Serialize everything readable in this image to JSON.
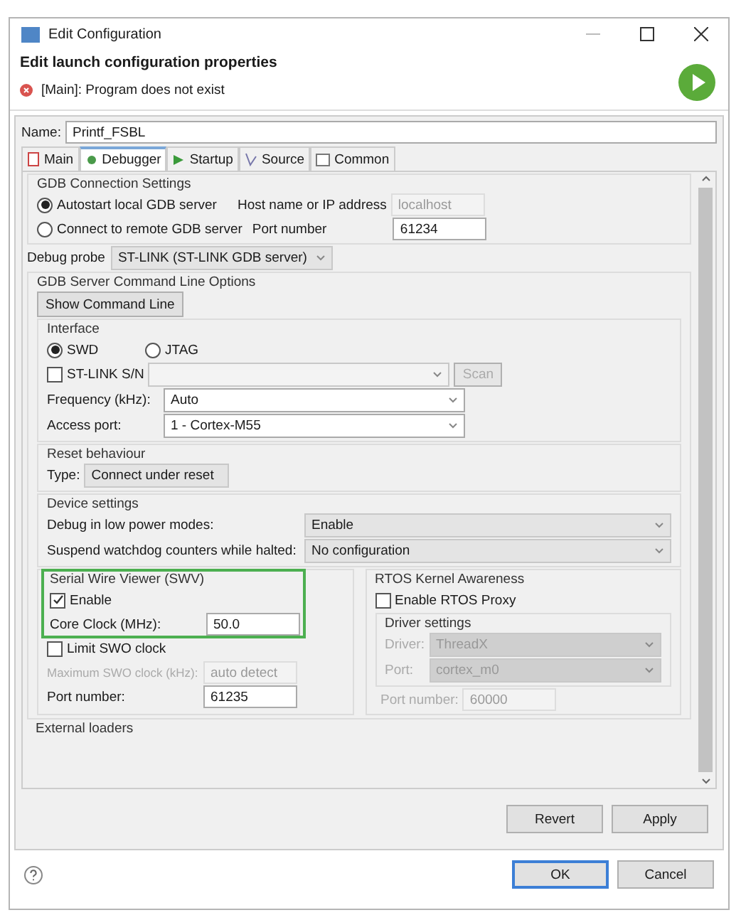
{
  "window": {
    "title": "Edit Configuration"
  },
  "header": {
    "title": "Edit launch configuration properties",
    "error": "[Main]: Program does not exist"
  },
  "name_field": {
    "label": "Name:",
    "value": "Printf_FSBL"
  },
  "tabs": [
    {
      "label": "Main",
      "selected": false
    },
    {
      "label": "Debugger",
      "selected": true
    },
    {
      "label": "Startup",
      "selected": false
    },
    {
      "label": "Source",
      "selected": false
    },
    {
      "label": "Common",
      "selected": false
    }
  ],
  "gdb_connection": {
    "title": "GDB Connection Settings",
    "options": [
      {
        "label": "Autostart local GDB server",
        "selected": true
      },
      {
        "label": "Connect to remote GDB server",
        "selected": false
      }
    ],
    "host": {
      "label": "Host name or IP address",
      "value": "localhost",
      "disabled": true
    },
    "port": {
      "label": "Port number",
      "value": "61234",
      "disabled": false
    }
  },
  "debug_probe": {
    "label": "Debug probe",
    "value": "ST-LINK (ST-LINK GDB server)"
  },
  "server_options": {
    "title": "GDB Server Command Line Options",
    "show_command_line": "Show Command Line",
    "interface": {
      "title": "Interface",
      "modes": [
        {
          "label": "SWD",
          "selected": true
        },
        {
          "label": "JTAG",
          "selected": false
        }
      ],
      "serial": {
        "label": "ST-LINK S/N",
        "checked": false,
        "value_disabled": true,
        "scan": "Scan"
      },
      "frequency": {
        "label": "Frequency (kHz):",
        "value": "Auto"
      },
      "access_port": {
        "label": "Access port:",
        "value": "1 - Cortex-M55"
      }
    },
    "reset": {
      "title": "Reset behaviour",
      "type": {
        "label": "Type:",
        "value": "Connect under reset"
      }
    },
    "device": {
      "title": "Device settings",
      "rows": [
        {
          "label": "Debug in low power modes:",
          "value": "Enable"
        },
        {
          "label": "Suspend watchdog counters while halted:",
          "value": "No configuration"
        }
      ]
    }
  },
  "swv": {
    "title": "Serial Wire Viewer (SWV)",
    "enable": {
      "label": "Enable",
      "checked": true
    },
    "core_clock": {
      "label": "Core Clock (MHz):",
      "value": "50.0"
    },
    "limit": {
      "label": "Limit SWO clock",
      "checked": false
    },
    "max_clock": {
      "label": "Maximum SWO clock (kHz):",
      "value": "auto detect",
      "disabled": true
    },
    "port": {
      "label": "Port number:",
      "value": "61235",
      "disabled": false
    }
  },
  "rtos": {
    "title": "RTOS Kernel Awareness",
    "enable": {
      "label": "Enable RTOS Proxy",
      "checked": false
    },
    "driver_settings": {
      "title": "Driver settings",
      "fields": [
        {
          "label": "Driver:",
          "value": "ThreadX",
          "disabled": true
        },
        {
          "label": "Port:",
          "value": "cortex_m0",
          "disabled": true
        }
      ]
    },
    "port_number": {
      "label": "Port number:",
      "value": "60000",
      "disabled": true
    }
  },
  "external_loaders": {
    "title": "External loaders"
  },
  "apply_buttons": [
    {
      "label": "Revert",
      "default": false
    },
    {
      "label": "Apply",
      "default": false
    }
  ],
  "dialog_buttons": [
    {
      "label": "OK",
      "default": true
    },
    {
      "label": "Cancel",
      "default": false
    }
  ]
}
